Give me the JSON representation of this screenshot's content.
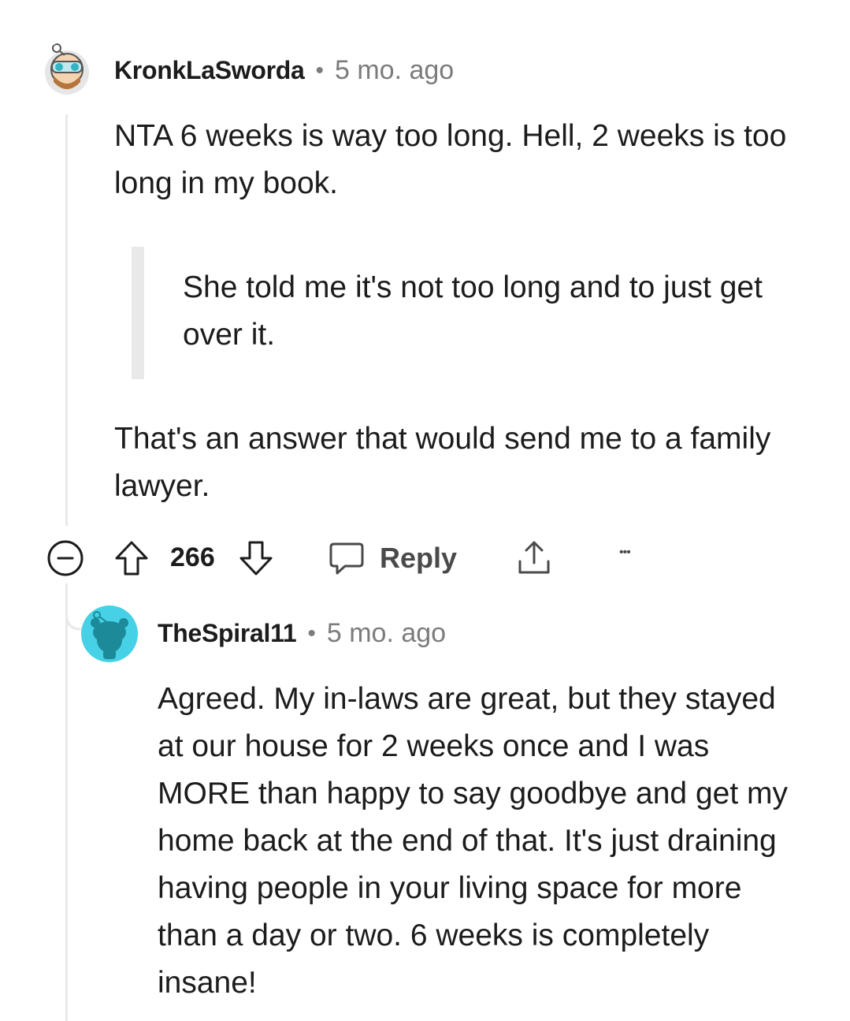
{
  "comment": {
    "username": "KronkLaSworda",
    "separator": "•",
    "time": "5 mo. ago",
    "paragraph1": "NTA 6 weeks is way too long. Hell, 2 weeks is too long in my book.",
    "quote": "She told me it's not too long and to just get over it.",
    "paragraph2": "That's an answer that would send me to a family lawyer.",
    "score": "266",
    "reply_label": "Reply",
    "more_label": "•••"
  },
  "reply": {
    "username": "TheSpiral11",
    "separator": "•",
    "time": "5 mo. ago",
    "text": "Agreed. My in-laws are great, but they stayed at our house for 2 weeks once and I was MORE than happy to say goodbye and get my home back at the end of that. It's just draining having people in your living space for more than a day or two. 6 weeks is completely insane!"
  },
  "colors": {
    "text": "#1c1c1c",
    "muted": "#7c7c7c",
    "thread_line": "#e9e9e9",
    "reply_avatar_bg": "#46d1e6",
    "reply_avatar_fg": "#1c8a99"
  },
  "icons": {
    "collapse": "collapse-icon",
    "upvote": "upvote-icon",
    "downvote": "downvote-icon",
    "reply": "comment-bubble-icon",
    "share": "share-icon",
    "more": "more-options-icon"
  }
}
